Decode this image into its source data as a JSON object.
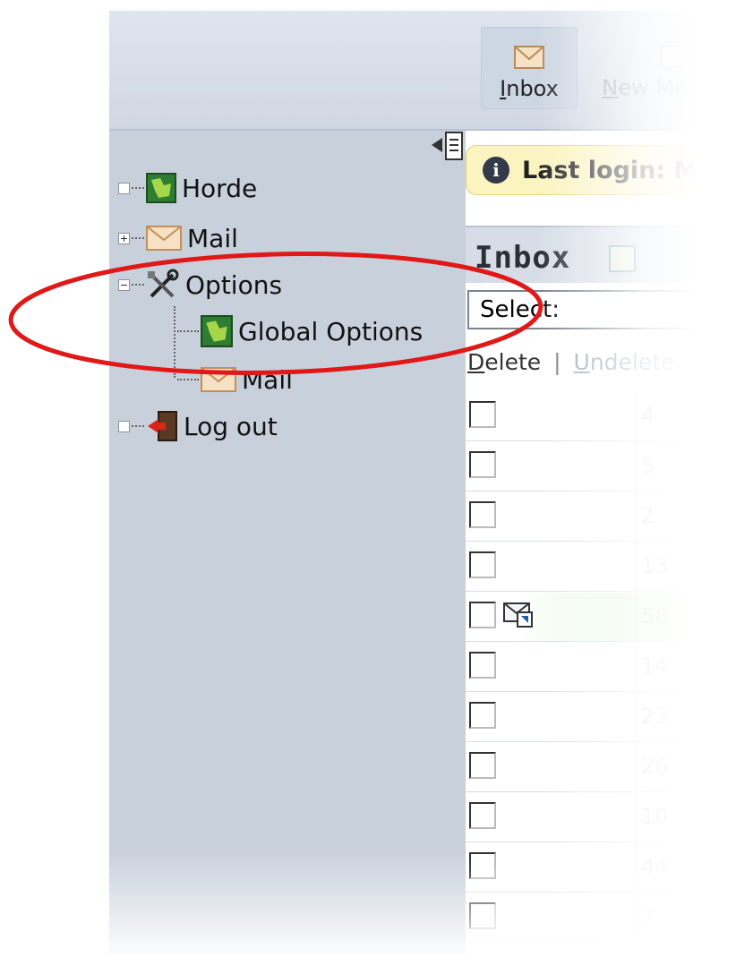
{
  "toolbar": {
    "inbox_label_first": "I",
    "inbox_label_rest": "nbox",
    "newmsg_label_first": "N",
    "newmsg_label_rest": "ew Me"
  },
  "sidebar": {
    "items": [
      {
        "label": "Horde",
        "icon": "horde-icon",
        "expander": "none"
      },
      {
        "label": "Mail",
        "icon": "mail-envelope-icon",
        "expander": "plus"
      },
      {
        "label": "Options",
        "icon": "tools-icon",
        "expander": "minus"
      },
      {
        "label": "Global Options",
        "icon": "horde-icon"
      },
      {
        "label": "Mail",
        "icon": "mail-envelope-icon"
      },
      {
        "label": "Log out",
        "icon": "logout-door-icon",
        "expander": "none"
      }
    ]
  },
  "notice": {
    "text": "Last login: M"
  },
  "inbox": {
    "title": "Inbox",
    "select_value": "Select:",
    "actions": {
      "delete_first": "D",
      "delete_rest": "elete",
      "separator": "|",
      "undelete_first": "U",
      "undelete_rest": "ndelete"
    },
    "rows": [
      {
        "num": "4"
      },
      {
        "num": "5"
      },
      {
        "num": "2"
      },
      {
        "num": "13"
      },
      {
        "num": "58",
        "forwarded": true,
        "highlight": true
      },
      {
        "num": "14"
      },
      {
        "num": "23"
      },
      {
        "num": "26"
      },
      {
        "num": "10"
      },
      {
        "num": "44"
      },
      {
        "num": "7"
      }
    ]
  },
  "colors": {
    "sidebar_bg": "#c8d0dc",
    "notice_bg": "#fbf3c0",
    "annotation_red": "#e01818",
    "highlight_row": "#e4f7dc"
  }
}
